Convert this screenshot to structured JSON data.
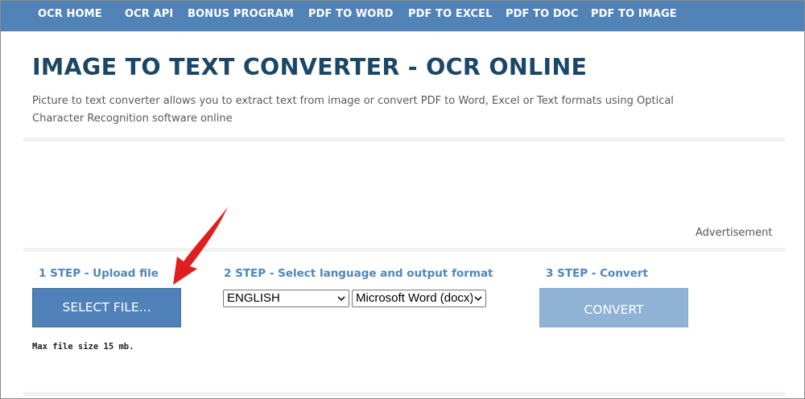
{
  "nav": {
    "items": [
      {
        "label": "OCR HOME"
      },
      {
        "label": "OCR API"
      },
      {
        "label": "BONUS PROGRAM"
      },
      {
        "label": "PDF TO WORD"
      },
      {
        "label": "PDF TO EXCEL"
      },
      {
        "label": "PDF TO DOC"
      },
      {
        "label": "PDF TO IMAGE"
      }
    ]
  },
  "header": {
    "title": "IMAGE TO TEXT CONVERTER - OCR ONLINE",
    "description": "Picture to text converter allows you to extract text from image or convert PDF to Word, Excel or Text formats using Optical Character Recognition software online"
  },
  "ad": {
    "label": "Advertisement"
  },
  "steps": {
    "step1": {
      "label": "1 STEP - Upload file",
      "button": "SELECT FILE...",
      "note": "Max file size 15 mb."
    },
    "step2": {
      "label": "2 STEP - Select language and output format",
      "language": "ENGLISH",
      "format": "Microsoft Word (docx)"
    },
    "step3": {
      "label": "3 STEP - Convert",
      "button": "CONVERT"
    }
  },
  "colors": {
    "navbar": "#5283b7",
    "title": "#1b4766",
    "step_label": "#4f86bb",
    "select_button": "#5081b8",
    "convert_button_disabled": "#90b2d4",
    "annotation_arrow": "#e01e1e"
  },
  "icons": {
    "dropdown": "chevron-down-icon",
    "annotation": "red-arrow-icon"
  }
}
